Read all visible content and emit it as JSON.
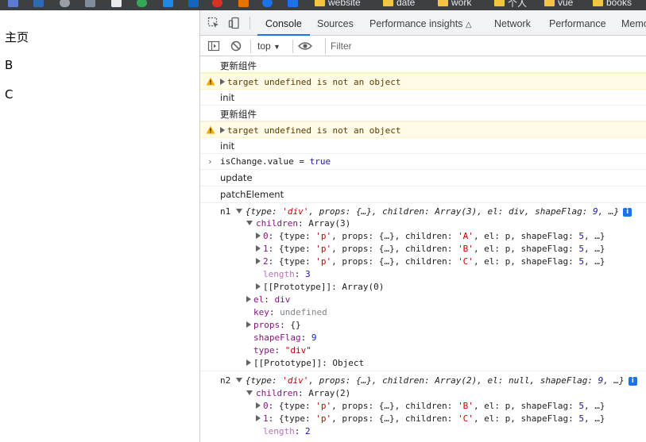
{
  "bookmarks": [
    {
      "label": "website"
    },
    {
      "label": "date"
    },
    {
      "label": "work"
    },
    {
      "label": "个人"
    },
    {
      "label": "vue"
    },
    {
      "label": "books"
    }
  ],
  "page": {
    "lines": [
      "主页",
      "B",
      "C"
    ]
  },
  "devtools": {
    "tabs": [
      "Console",
      "Sources",
      "Performance insights",
      "Network",
      "Performance",
      "Memo"
    ],
    "context": "top",
    "filter_placeholder": "Filter",
    "console": {
      "log1": "更新组件",
      "warn1": "target undefined is not an object",
      "init1": "init",
      "log2": "更新组件",
      "warn2": "target undefined is not an object",
      "init2": "init",
      "input": {
        "name": "isChange.value",
        "op": " = ",
        "val": "true"
      },
      "update": "update",
      "patch": "patchElement",
      "n1": {
        "label": "n1",
        "summary": {
          "t1": "{type: ",
          "type": "'div'",
          "t2": ", props: {…}, children: Array(3), el: div, shapeFlag: ",
          "flag": "9",
          "t3": ", …}"
        },
        "children_key": "children",
        "children_val": "Array(3)",
        "items": [
          {
            "idx": "0",
            "child": "'A'"
          },
          {
            "idx": "1",
            "child": "'B'"
          },
          {
            "idx": "2",
            "child": "'C'"
          }
        ],
        "item_pre": ": {type: ",
        "item_type": "'p'",
        "item_mid": ", props: {…}, children: ",
        "item_el": ", el: p, shapeFlag: ",
        "item_flag": "5",
        "item_end": ", …}",
        "length_key": "length",
        "length_val": "3",
        "proto_arr": "[[Prototype]]: Array(0)",
        "el_key": "el",
        "el_val": "div",
        "key_key": "key",
        "key_val": "undefined",
        "props_key": "props",
        "props_val": "{}",
        "shape_key": "shapeFlag",
        "shape_val": "9",
        "type_key": "type",
        "type_val": "\"div\"",
        "proto_obj": "[[Prototype]]: Object"
      },
      "n2": {
        "label": "n2",
        "summary": {
          "t1": "{type: ",
          "type": "'div'",
          "t2": ", props: {…}, children: Array(2), el: null, shapeFlag: ",
          "flag": "9",
          "t3": ", …}"
        },
        "children_key": "children",
        "children_val": "Array(2)",
        "items": [
          {
            "idx": "0",
            "child": "'B'"
          },
          {
            "idx": "1",
            "child": "'C'"
          }
        ],
        "length_key": "length",
        "length_val": "2"
      }
    }
  },
  "colors": {
    "accent": "#1a73e8",
    "warn_bg": "#fffbe6",
    "string": "#c80000",
    "number": "#1a1aa6",
    "key": "#881280"
  },
  "icons": [
    "inspect-icon",
    "device-toggle-icon",
    "sidebar-toggle-icon",
    "clear-console-icon",
    "eye-icon",
    "warning-icon",
    "info-icon",
    "folder-icon"
  ]
}
